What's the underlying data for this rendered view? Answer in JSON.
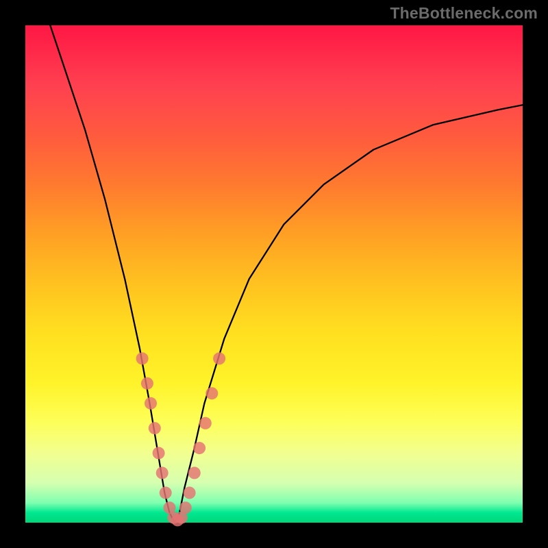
{
  "watermark": "TheBottleneck.com",
  "chart_data": {
    "type": "line",
    "title": "",
    "xlabel": "",
    "ylabel": "",
    "xlim": [
      0,
      100
    ],
    "ylim": [
      0,
      100
    ],
    "series": [
      {
        "name": "bottleneck-curve",
        "x": [
          5,
          8,
          12,
          16,
          20,
          23,
          25,
          27,
          28,
          29,
          30,
          31,
          32,
          34,
          36,
          40,
          45,
          52,
          60,
          70,
          82,
          95,
          100
        ],
        "y": [
          100,
          91,
          79,
          65,
          49,
          35,
          24,
          12,
          6,
          2,
          0,
          2,
          7,
          15,
          24,
          37,
          49,
          60,
          68,
          75,
          80,
          83,
          84
        ]
      }
    ],
    "markers": {
      "name": "highlighted-points",
      "color": "#e57373",
      "x": [
        23.5,
        24.5,
        25.2,
        26.0,
        26.8,
        27.5,
        28.2,
        29.0,
        29.8,
        30.6,
        31.4,
        32.2,
        33.0,
        34.0,
        35.0,
        36.2,
        37.5,
        39.0
      ],
      "y": [
        33,
        28,
        24,
        19,
        14,
        10,
        6,
        3,
        1,
        0.5,
        1,
        3,
        6,
        10,
        15,
        20,
        26,
        33
      ]
    }
  }
}
